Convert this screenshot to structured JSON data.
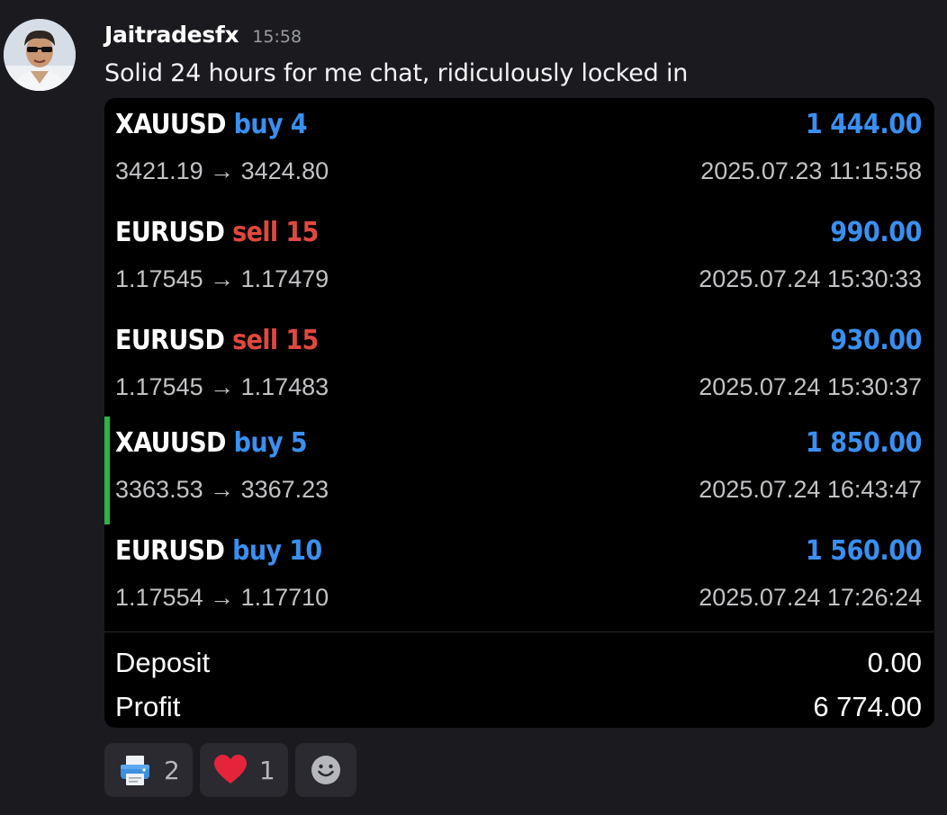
{
  "message": {
    "username": "Jaitradesfx",
    "timestamp": "15:58",
    "text": "Solid 24 hours for me chat, ridiculously locked in"
  },
  "trades": [
    {
      "symbol": "XAUUSD",
      "side": "buy 4",
      "side_type": "buy",
      "profit": "1 444.00",
      "prices": "3421.19 → 3424.80",
      "time": "2025.07.23 11:15:58",
      "highlighted": false
    },
    {
      "symbol": "EURUSD",
      "side": "sell 15",
      "side_type": "sell",
      "profit": "990.00",
      "prices": "1.17545 → 1.17479",
      "time": "2025.07.24 15:30:33",
      "highlighted": false
    },
    {
      "symbol": "EURUSD",
      "side": "sell 15",
      "side_type": "sell",
      "profit": "930.00",
      "prices": "1.17545 → 1.17483",
      "time": "2025.07.24 15:30:37",
      "highlighted": false
    },
    {
      "symbol": "XAUUSD",
      "side": "buy 5",
      "side_type": "buy",
      "profit": "1 850.00",
      "prices": "3363.53 → 3367.23",
      "time": "2025.07.24 16:43:47",
      "highlighted": true
    },
    {
      "symbol": "EURUSD",
      "side": "buy 10",
      "side_type": "buy",
      "profit": "1 560.00",
      "prices": "1.17554 → 1.17710",
      "time": "2025.07.24 17:26:24",
      "highlighted": false
    }
  ],
  "summary": {
    "deposit_label": "Deposit",
    "deposit_value": "0.00",
    "profit_label": "Profit",
    "profit_value": "6 774.00"
  },
  "reactions": [
    {
      "icon": "printer-icon",
      "count": "2"
    },
    {
      "icon": "heart-icon",
      "count": "1"
    },
    {
      "icon": "add-reaction-icon"
    }
  ],
  "colors": {
    "background": "#1b1b1f",
    "card": "#000000",
    "buy": "#3a8ff0",
    "sell": "#e0483e",
    "profit": "#3a8ff0",
    "highlight_bar": "#2fb344",
    "muted_text": "#c2c2c6"
  }
}
